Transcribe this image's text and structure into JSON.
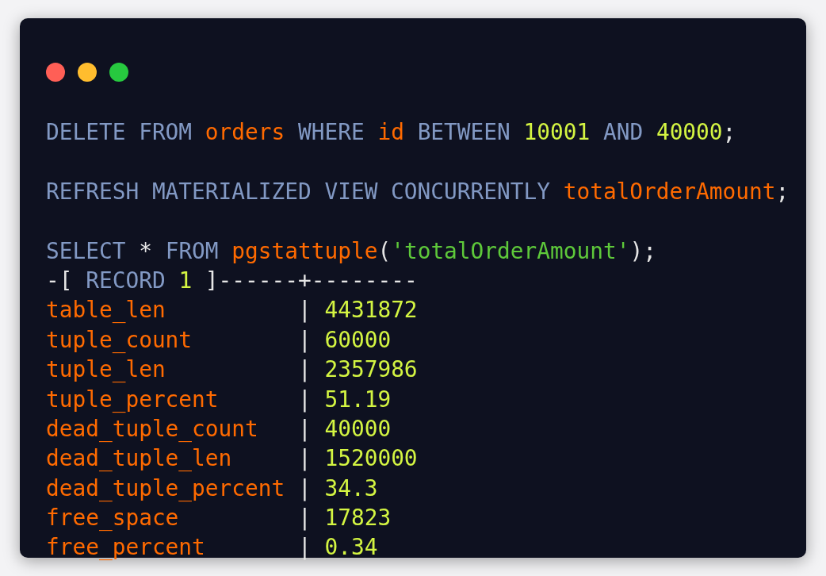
{
  "window": {
    "controls": [
      {
        "kind": "close"
      },
      {
        "kind": "minimize"
      },
      {
        "kind": "zoom"
      }
    ]
  },
  "blocks": [
    {
      "lines": [
        {
          "tokens": [
            {
              "kind": "keyword",
              "text": "DELETE FROM "
            },
            {
              "kind": "ident",
              "text": "orders"
            },
            {
              "kind": "keyword",
              "text": " WHERE "
            },
            {
              "kind": "ident",
              "text": "id"
            },
            {
              "kind": "keyword",
              "text": " BETWEEN "
            },
            {
              "kind": "number",
              "text": "10001"
            },
            {
              "kind": "keyword",
              "text": " AND "
            },
            {
              "kind": "number",
              "text": "40000"
            },
            {
              "kind": "punct",
              "text": ";"
            }
          ]
        }
      ]
    },
    {
      "lines": [
        {
          "tokens": [
            {
              "kind": "keyword",
              "text": "REFRESH MATERIALIZED VIEW CONCURRENTLY "
            },
            {
              "kind": "ident",
              "text": "totalOrderAmount"
            },
            {
              "kind": "punct",
              "text": ";"
            }
          ]
        }
      ]
    },
    {
      "lines": [
        {
          "tokens": [
            {
              "kind": "keyword",
              "text": "SELECT "
            },
            {
              "kind": "punct",
              "text": "* "
            },
            {
              "kind": "keyword",
              "text": "FROM "
            },
            {
              "kind": "ident",
              "text": "pgstattuple"
            },
            {
              "kind": "punct",
              "text": "("
            },
            {
              "kind": "string",
              "text": "'totalOrderAmount'"
            },
            {
              "kind": "punct",
              "text": ");"
            }
          ]
        },
        {
          "tokens": [
            {
              "kind": "punct",
              "text": "-[ "
            },
            {
              "kind": "keyword",
              "text": "RECORD "
            },
            {
              "kind": "number",
              "text": "1"
            },
            {
              "kind": "punct",
              "text": " ]------+--------"
            }
          ]
        },
        {
          "tokens": [
            {
              "kind": "ident",
              "text": "table_len"
            },
            {
              "kind": "punct",
              "text": "          | "
            },
            {
              "kind": "number",
              "text": "4431872"
            }
          ]
        },
        {
          "tokens": [
            {
              "kind": "ident",
              "text": "tuple_count"
            },
            {
              "kind": "punct",
              "text": "        | "
            },
            {
              "kind": "number",
              "text": "60000"
            }
          ]
        },
        {
          "tokens": [
            {
              "kind": "ident",
              "text": "tuple_len"
            },
            {
              "kind": "punct",
              "text": "          | "
            },
            {
              "kind": "number",
              "text": "2357986"
            }
          ]
        },
        {
          "tokens": [
            {
              "kind": "ident",
              "text": "tuple_percent"
            },
            {
              "kind": "punct",
              "text": "      | "
            },
            {
              "kind": "number",
              "text": "51.19"
            }
          ]
        },
        {
          "tokens": [
            {
              "kind": "ident",
              "text": "dead_tuple_count"
            },
            {
              "kind": "punct",
              "text": "   | "
            },
            {
              "kind": "number",
              "text": "40000"
            }
          ]
        },
        {
          "tokens": [
            {
              "kind": "ident",
              "text": "dead_tuple_len"
            },
            {
              "kind": "punct",
              "text": "     | "
            },
            {
              "kind": "number",
              "text": "1520000"
            }
          ]
        },
        {
          "tokens": [
            {
              "kind": "ident",
              "text": "dead_tuple_percent"
            },
            {
              "kind": "punct",
              "text": " | "
            },
            {
              "kind": "number",
              "text": "34.3"
            }
          ]
        },
        {
          "tokens": [
            {
              "kind": "ident",
              "text": "free_space"
            },
            {
              "kind": "punct",
              "text": "         | "
            },
            {
              "kind": "number",
              "text": "17823"
            }
          ]
        },
        {
          "tokens": [
            {
              "kind": "ident",
              "text": "free_percent"
            },
            {
              "kind": "punct",
              "text": "       | "
            },
            {
              "kind": "number",
              "text": "0.34"
            }
          ]
        }
      ]
    }
  ]
}
